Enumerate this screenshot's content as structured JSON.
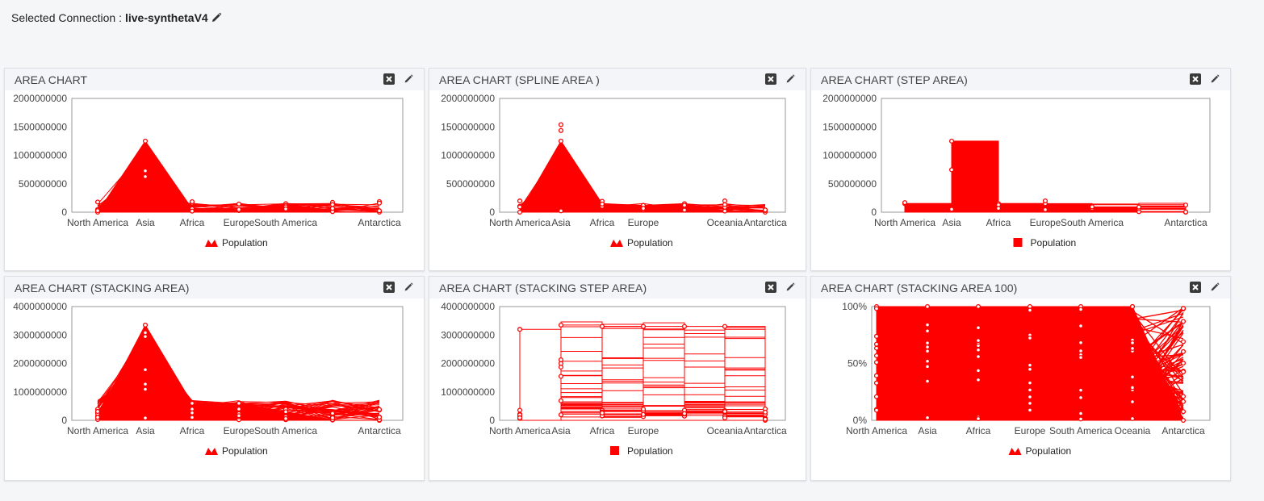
{
  "header": {
    "label": "Selected Connection :",
    "connection_name": "live-synthetaV4"
  },
  "panels": [
    {
      "title": "AREA CHART"
    },
    {
      "title": "AREA CHART (SPLINE AREA )"
    },
    {
      "title": "AREA CHART (STEP AREA)"
    },
    {
      "title": "AREA CHART (STACKING AREA)"
    },
    {
      "title": "AREA CHART (STACKING STEP AREA)"
    },
    {
      "title": "AREA CHART (STACKING AREA 100)"
    }
  ],
  "chart_data": [
    {
      "type": "area",
      "title": "AREA CHART",
      "x_tick_labels": [
        "North America",
        "Asia",
        "Africa",
        "Europe",
        "South America",
        "Antarctica"
      ],
      "y_tick_labels": [
        "0",
        "500000000",
        "1000000000",
        "1500000000",
        "2000000000"
      ],
      "ylim": [
        0,
        2000000000
      ],
      "legend": "Population",
      "legend_position": "bottom",
      "color": "#ff0000",
      "series": [
        {
          "name": "Population",
          "values": [
            0,
            1250000000,
            60000000,
            40000000,
            150000000,
            10000000,
            0
          ]
        }
      ]
    },
    {
      "type": "area",
      "title": "AREA CHART (SPLINE AREA )",
      "x_tick_labels": [
        "North America",
        "Asia",
        "Africa",
        "Europe",
        "Oceania",
        "Antarctica"
      ],
      "y_tick_labels": [
        "0",
        "500000000",
        "1000000000",
        "1500000000",
        "2000000000"
      ],
      "ylim": [
        0,
        2000000000
      ],
      "legend": "Population",
      "legend_position": "bottom",
      "color": "#ff0000",
      "series": [
        {
          "name": "Population",
          "values": [
            0,
            1250000000,
            150000000,
            120000000,
            150000000,
            20000000,
            0
          ]
        }
      ]
    },
    {
      "type": "area",
      "title": "AREA CHART (STEP AREA)",
      "x_tick_labels": [
        "North America",
        "Asia",
        "Africa",
        "Europe",
        "South America",
        "Antarctica"
      ],
      "y_tick_labels": [
        "0",
        "500000000",
        "1000000000",
        "1500000000",
        "2000000000"
      ],
      "ylim": [
        0,
        2000000000
      ],
      "legend": "Population",
      "legend_position": "bottom",
      "color": "#ff0000",
      "series": [
        {
          "name": "Population",
          "values": [
            150000000,
            1250000000,
            150000000,
            150000000,
            80000000,
            10000000,
            0
          ]
        }
      ]
    },
    {
      "type": "area",
      "title": "AREA CHART (STACKING AREA)",
      "x_tick_labels": [
        "North America",
        "Asia",
        "Africa",
        "Europe",
        "South America",
        "Antarctica"
      ],
      "y_tick_labels": [
        "0",
        "1000000000",
        "2000000000",
        "3000000000",
        "4000000000"
      ],
      "ylim": [
        0,
        4000000000
      ],
      "legend": "Population",
      "legend_position": "bottom",
      "color": "#ff0000",
      "series": [
        {
          "name": "Population",
          "values": [
            150000000,
            3350000000,
            600000000,
            600000000,
            300000000,
            10000000,
            0
          ]
        }
      ]
    },
    {
      "type": "area",
      "title": "AREA CHART (STACKING STEP AREA)",
      "x_tick_labels": [
        "North America",
        "Asia",
        "Africa",
        "Europe",
        "Oceania",
        "Antarctica"
      ],
      "y_tick_labels": [
        "0",
        "1000000000",
        "2000000000",
        "3000000000",
        "4000000000"
      ],
      "ylim": [
        0,
        4000000000
      ],
      "legend": "Population",
      "legend_position": "bottom",
      "color": "#ff0000",
      "series": [
        {
          "name": "Population",
          "values": [
            3200000000,
            3350000000,
            3300000000,
            3300000000,
            3300000000,
            3300000000,
            0
          ]
        }
      ]
    },
    {
      "type": "area",
      "title": "AREA CHART (STACKING AREA 100)",
      "x_tick_labels": [
        "North America",
        "Asia",
        "Africa",
        "Europe",
        "South America",
        "Oceania",
        "Antarctica"
      ],
      "y_tick_labels": [
        "0%",
        "50%",
        "100%"
      ],
      "ylim": [
        0,
        100
      ],
      "legend": "Population",
      "legend_position": "bottom",
      "color": "#ff0000",
      "series": [
        {
          "name": "Population",
          "values": [
            100,
            100,
            100,
            100,
            100,
            100,
            0
          ]
        }
      ]
    }
  ]
}
